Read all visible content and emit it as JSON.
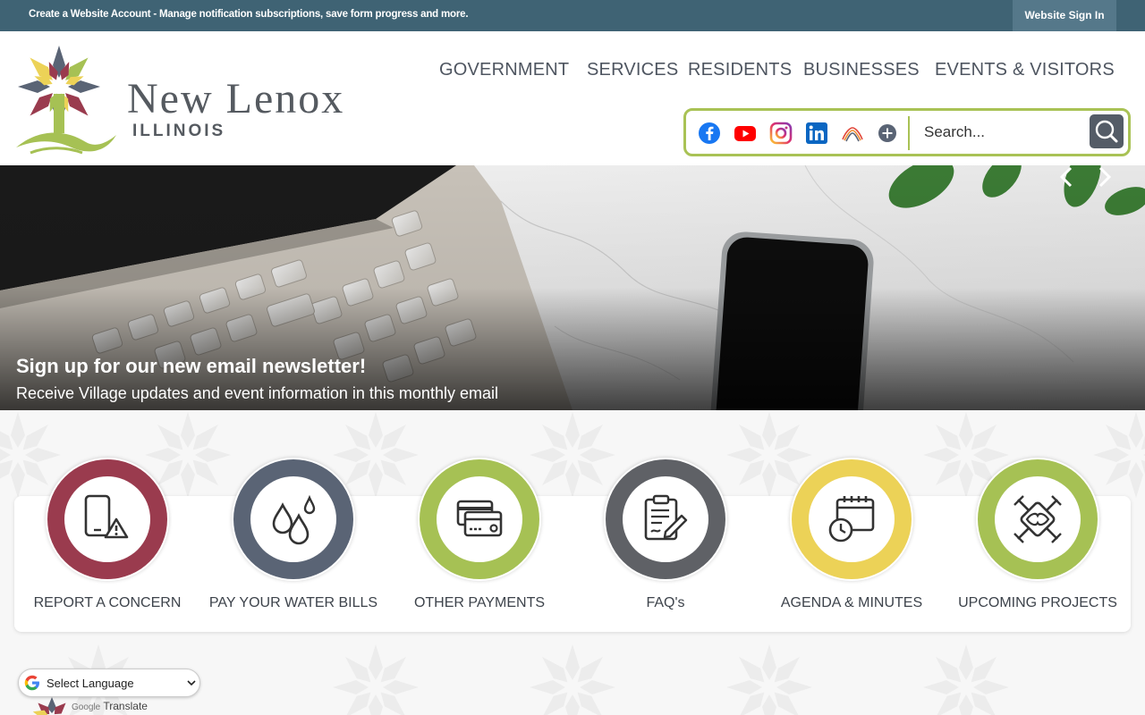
{
  "topbar": {
    "account_text": "Create a Website Account - Manage notification subscriptions, save form progress and more.",
    "signin_label": "Website Sign In"
  },
  "logo": {
    "name": "New Lenox",
    "state": "ILLINOIS"
  },
  "nav": {
    "items": [
      {
        "label": "GOVERNMENT"
      },
      {
        "label": "SERVICES"
      },
      {
        "label": "RESIDENTS"
      },
      {
        "label": "BUSINESSES"
      },
      {
        "label": "EVENTS & VISITORS"
      }
    ]
  },
  "social": {
    "icons": [
      "facebook-icon",
      "youtube-icon",
      "instagram-icon",
      "linkedin-icon",
      "stream-icon",
      "more-icon"
    ]
  },
  "search": {
    "placeholder": "Search..."
  },
  "hero": {
    "title": "Sign up for our new email newsletter!",
    "subtitle": "Receive Village updates and event information in this monthly email"
  },
  "quick_links": [
    {
      "label": "REPORT A CONCERN",
      "color": "#9a3b4e",
      "icon": "phone-alert-icon"
    },
    {
      "label": "PAY YOUR WATER BILLS",
      "color": "#5a6475",
      "icon": "water-drops-icon"
    },
    {
      "label": "OTHER PAYMENTS",
      "color": "#a6c154",
      "icon": "credit-card-icon"
    },
    {
      "label": "FAQ's",
      "color": "#5f6166",
      "icon": "clipboard-icon"
    },
    {
      "label": "AGENDA & MINUTES",
      "color": "#ecd257",
      "icon": "calendar-clock-icon"
    },
    {
      "label": "UPCOMING PROJECTS",
      "color": "#a6c154",
      "icon": "gears-icon"
    }
  ],
  "translate": {
    "select_label": "Select Language",
    "powered_prefix": "Google",
    "powered_suffix": "Translate"
  },
  "colors": {
    "topbar": "#3f6374",
    "accent_green": "#a9c255",
    "nav_text": "#4e5560"
  }
}
